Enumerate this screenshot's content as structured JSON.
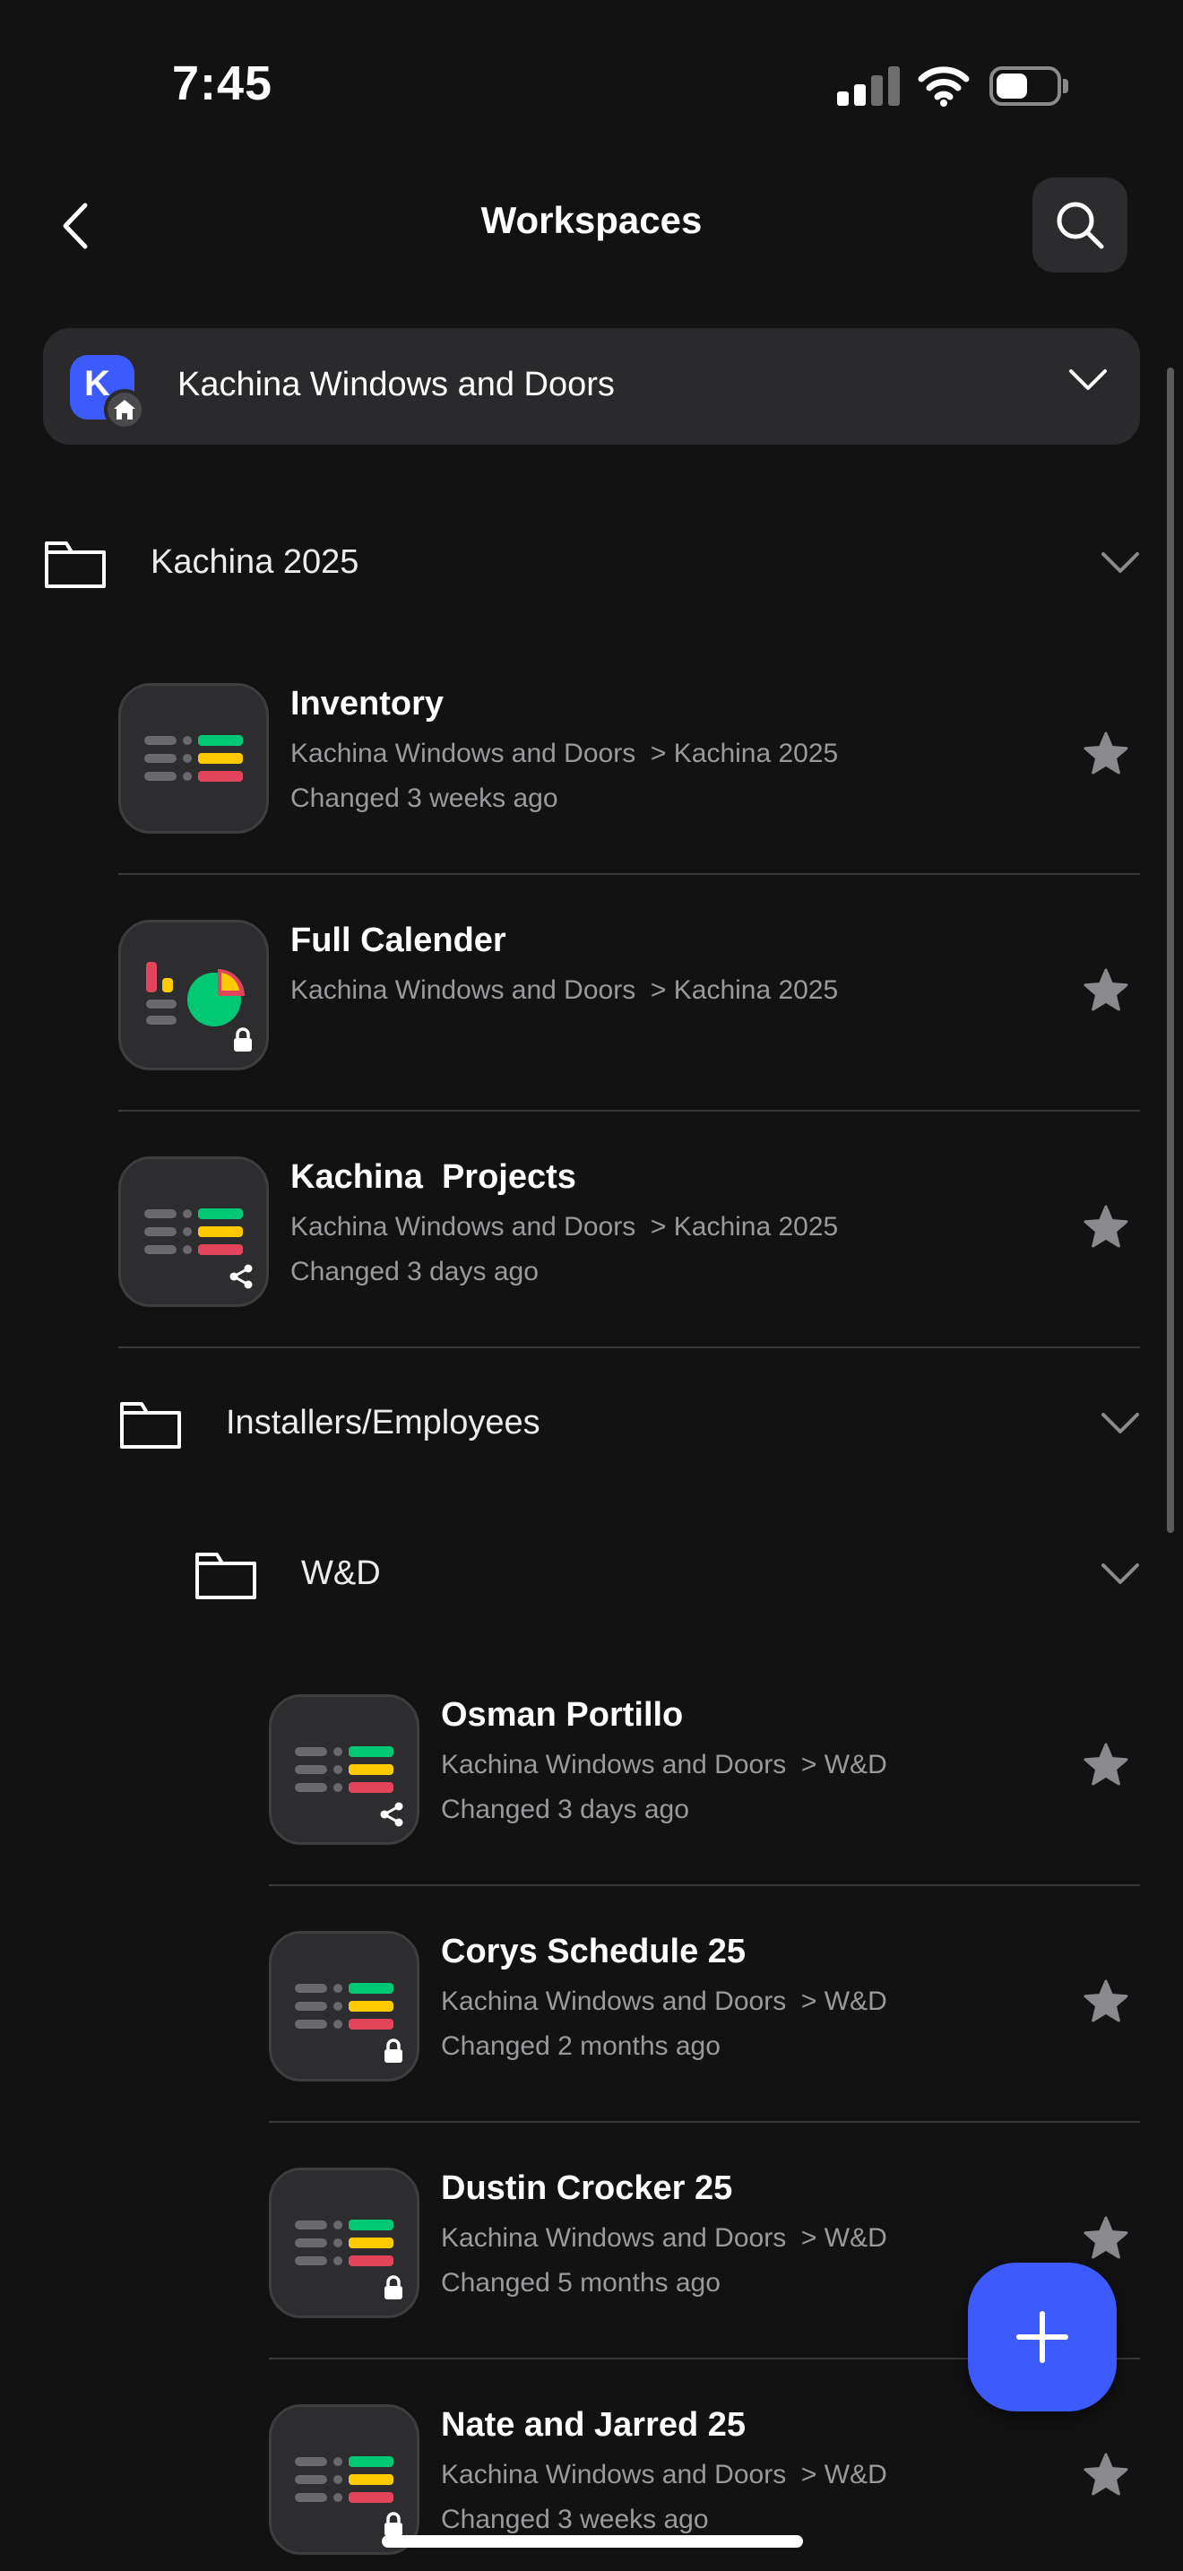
{
  "status_bar": {
    "time": "7:45"
  },
  "header": {
    "title": "Workspaces"
  },
  "workspace": {
    "name": "Kachina Windows and Doors",
    "avatar_letter": "K",
    "accent": "#3d5afe"
  },
  "folders": [
    {
      "label": "Kachina 2025"
    },
    {
      "label": "Installers/Employees"
    },
    {
      "label": "W&D"
    }
  ],
  "items": [
    {
      "title": "Inventory",
      "path": "Kachina Windows and Doors",
      "sep": ">",
      "folder": "Kachina 2025",
      "changed": "Changed 3 weeks ago",
      "icon": "board-icon",
      "badge": "none"
    },
    {
      "title": "Full Calender",
      "path": "Kachina Windows and Doors",
      "sep": ">",
      "folder": "Kachina 2025",
      "changed": "",
      "icon": "dashboard-icon",
      "badge": "lock-icon"
    },
    {
      "title": "Kachina  Projects",
      "path": "Kachina Windows and Doors",
      "sep": ">",
      "folder": "Kachina 2025",
      "changed": "Changed 3 days ago",
      "icon": "board-icon",
      "badge": "share-icon"
    },
    {
      "title": "Osman Portillo",
      "path": "Kachina Windows and Doors",
      "sep": ">",
      "folder": "W&D",
      "changed": "Changed 3 days ago",
      "icon": "board-icon",
      "badge": "share-icon"
    },
    {
      "title": "Corys Schedule 25",
      "path": "Kachina Windows and Doors",
      "sep": ">",
      "folder": "W&D",
      "changed": "Changed 2 months ago",
      "icon": "board-icon",
      "badge": "lock-icon"
    },
    {
      "title": "Dustin Crocker 25",
      "path": "Kachina Windows and Doors",
      "sep": ">",
      "folder": "W&D",
      "changed": "Changed 5 months ago",
      "icon": "board-icon",
      "badge": "lock-icon"
    },
    {
      "title": "Nate and Jarred 25",
      "path": "Kachina Windows and Doors",
      "sep": ">",
      "folder": "W&D",
      "changed": "Changed 3 weeks ago",
      "icon": "board-icon",
      "badge": "lock-icon"
    }
  ],
  "colors": {
    "green": "#00c875",
    "yellow": "#ffcb00",
    "red": "#e2445c",
    "star": "#8a8a8e"
  }
}
